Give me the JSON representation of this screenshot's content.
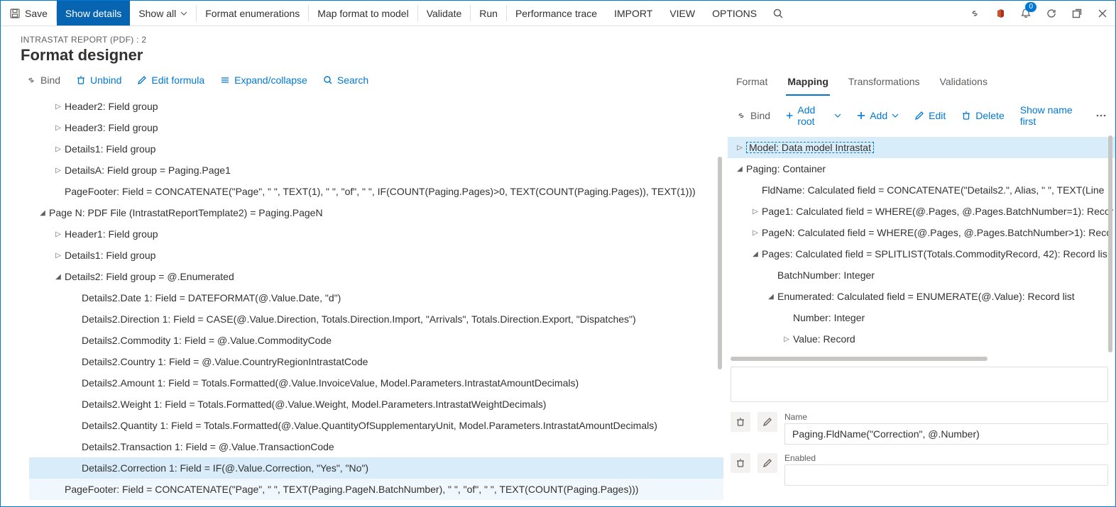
{
  "topbar": {
    "save": "Save",
    "show_details": "Show details",
    "show_all": "Show all",
    "format_enum": "Format enumerations",
    "map_format": "Map format to model",
    "validate": "Validate",
    "run": "Run",
    "perf_trace": "Performance trace",
    "import": "IMPORT",
    "view": "VIEW",
    "options": "OPTIONS",
    "notifications_count": "0"
  },
  "header": {
    "breadcrumb": "INTRASTAT REPORT (PDF) : 2",
    "title": "Format designer"
  },
  "left_toolbar": {
    "bind": "Bind",
    "unbind": "Unbind",
    "edit_formula": "Edit formula",
    "expand_collapse": "Expand/collapse",
    "search": "Search"
  },
  "tree": {
    "n0": "Header2: Field group",
    "n1": "Header3: Field group",
    "n2": "Details1: Field group",
    "n3": "DetailsA: Field group = Paging.Page1",
    "n4": "PageFooter: Field = CONCATENATE(\"Page\", \" \", TEXT(1), \" \", \"of\", \" \", IF(COUNT(Paging.Pages)>0, TEXT(COUNT(Paging.Pages)), TEXT(1)))",
    "n5": "Page N: PDF File (IntrastatReportTemplate2) = Paging.PageN",
    "n6": "Header1: Field group",
    "n7": "Details1: Field group",
    "n8": "Details2: Field group = @.Enumerated",
    "n9": "Details2.Date 1: Field = DATEFORMAT(@.Value.Date, \"d\")",
    "n10": "Details2.Direction 1: Field = CASE(@.Value.Direction, Totals.Direction.Import, \"Arrivals\", Totals.Direction.Export, \"Dispatches\")",
    "n11": "Details2.Commodity 1: Field = @.Value.CommodityCode",
    "n12": "Details2.Country 1: Field = @.Value.CountryRegionIntrastatCode",
    "n13": "Details2.Amount 1: Field = Totals.Formatted(@.Value.InvoiceValue, Model.Parameters.IntrastatAmountDecimals)",
    "n14": "Details2.Weight 1: Field = Totals.Formatted(@.Value.Weight, Model.Parameters.IntrastatWeightDecimals)",
    "n15": "Details2.Quantity 1: Field = Totals.Formatted(@.Value.QuantityOfSupplementaryUnit, Model.Parameters.IntrastatAmountDecimals)",
    "n16": "Details2.Transaction 1: Field = @.Value.TransactionCode",
    "n17": "Details2.Correction 1: Field = IF(@.Value.Correction, \"Yes\", \"No\")",
    "n18": "PageFooter: Field = CONCATENATE(\"Page\", \" \", TEXT(Paging.PageN.BatchNumber), \" \", \"of\", \" \", TEXT(COUNT(Paging.Pages)))"
  },
  "right": {
    "tabs": {
      "format": "Format",
      "mapping": "Mapping",
      "transformations": "Transformations",
      "validations": "Validations"
    },
    "toolbar": {
      "bind": "Bind",
      "add_root": "Add root",
      "add": "Add",
      "edit": "Edit",
      "delete": "Delete",
      "show_name_first": "Show name first"
    },
    "tree": {
      "r0": "Model: Data model Intrastat",
      "r1": "Paging: Container",
      "r2": "FldName: Calculated field = CONCATENATE(\"Details2.\", Alias, \" \", TEXT(Line",
      "r3": "Page1: Calculated field = WHERE(@.Pages, @.Pages.BatchNumber=1): Recor",
      "r4": "PageN: Calculated field = WHERE(@.Pages, @.Pages.BatchNumber>1): Recc",
      "r5": "Pages: Calculated field = SPLITLIST(Totals.CommodityRecord, 42): Record lis",
      "r6": "BatchNumber: Integer",
      "r7": "Enumerated: Calculated field = ENUMERATE(@.Value): Record list",
      "r8": "Number: Integer",
      "r9": "Value: Record"
    },
    "props": {
      "name_label": "Name",
      "name_value": "Paging.FldName(\"Correction\", @.Number)",
      "enabled_label": "Enabled"
    }
  }
}
